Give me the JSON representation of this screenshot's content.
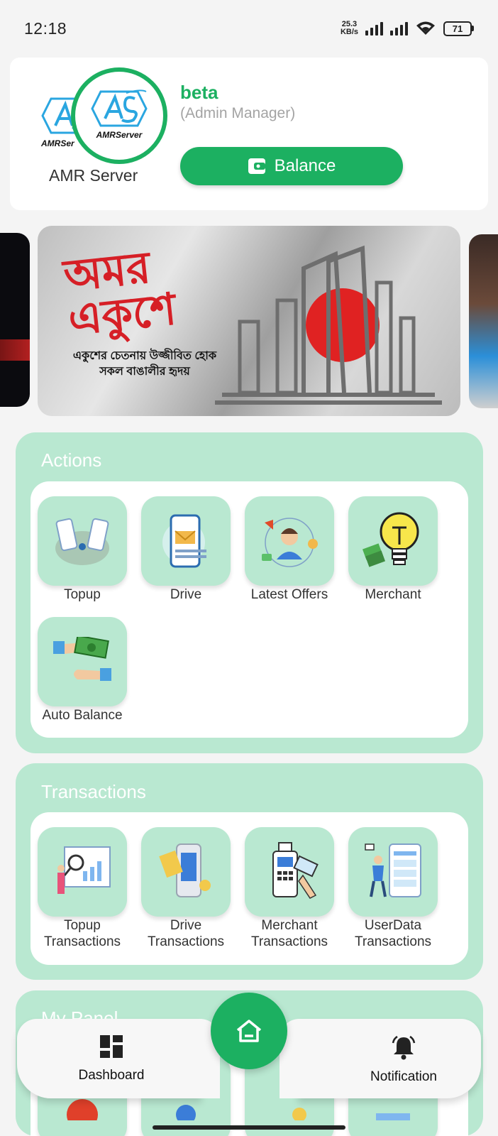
{
  "status_bar": {
    "time": "12:18",
    "net_speed_value": "25.3",
    "net_speed_unit": "KB/s",
    "battery": "71"
  },
  "profile": {
    "logo_text_back": "AMRSer",
    "logo_text": "AMRServer",
    "company_name": "AMR Server",
    "user_name": "beta",
    "user_role": "(Admin Manager)",
    "balance_label": "Balance"
  },
  "banner": {
    "title_line1": "অমর",
    "title_line2": "একুশে",
    "subtitle_line1": "একুশের চেতনায় উজ্জীবিত হোক",
    "subtitle_line2": "সকল বাঙালীর হৃদয়"
  },
  "actions": {
    "title": "Actions",
    "items": [
      {
        "label": "Topup",
        "icon": "phone-transfer-icon"
      },
      {
        "label": "Drive",
        "icon": "mobile-mail-icon"
      },
      {
        "label": "Latest Offers",
        "icon": "support-agent-icon"
      },
      {
        "label": "Merchant",
        "icon": "lightbulb-money-icon"
      },
      {
        "label": "Auto Balance",
        "icon": "cash-handover-icon"
      }
    ]
  },
  "transactions": {
    "title": "Transactions",
    "items": [
      {
        "label_line1": "Topup",
        "label_line2": "Transactions",
        "icon": "report-analysis-icon"
      },
      {
        "label_line1": "Drive",
        "label_line2": "Transactions",
        "icon": "atm-card-icon"
      },
      {
        "label_line1": "Merchant",
        "label_line2": "Transactions",
        "icon": "pos-terminal-icon"
      },
      {
        "label_line1": "UserData",
        "label_line2": "Transactions",
        "icon": "user-dashboard-icon"
      }
    ]
  },
  "my_panel": {
    "title": "My Panel"
  },
  "bottom_nav": {
    "dashboard_label": "Dashboard",
    "notification_label": "Notification"
  },
  "colors": {
    "accent": "#1cb061",
    "section_bg": "#b9e8d1"
  }
}
